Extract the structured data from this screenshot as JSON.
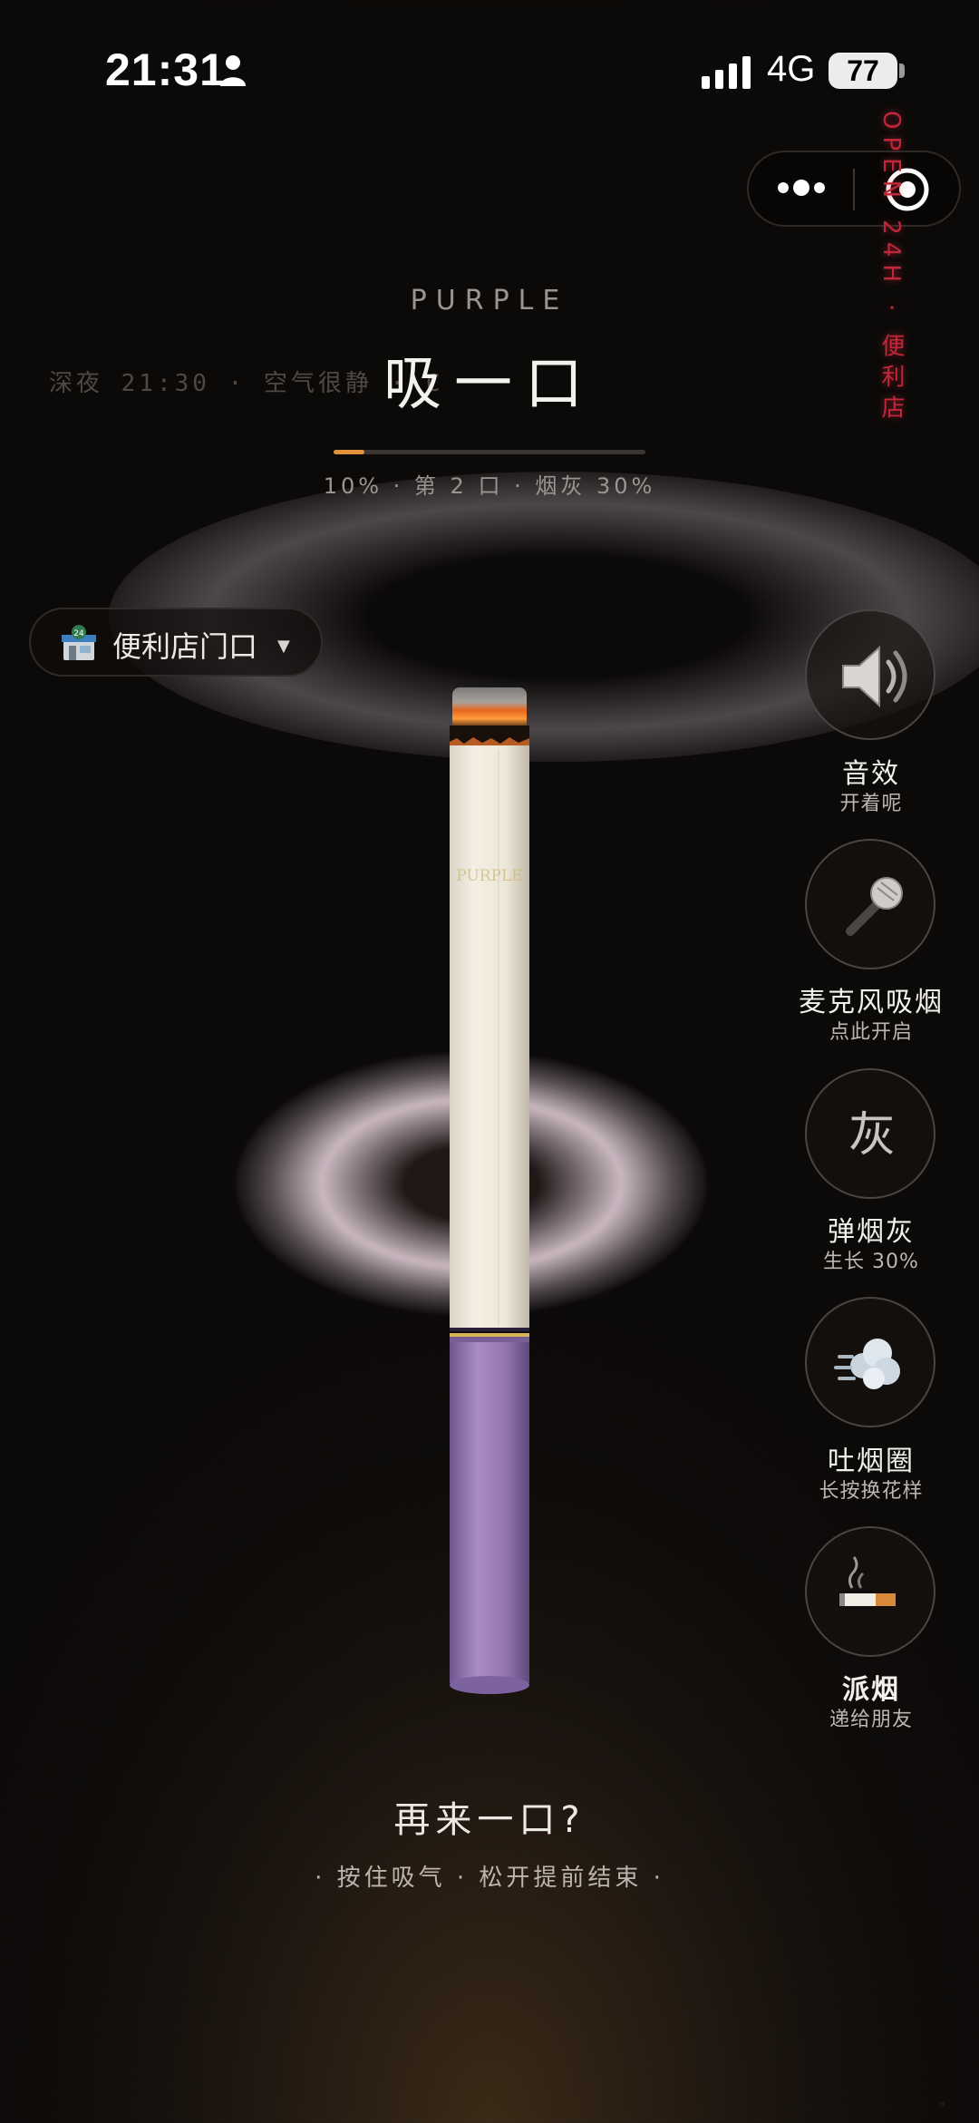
{
  "status_bar": {
    "time": "21:31",
    "network": "4G",
    "battery": "77"
  },
  "neon_sign": "OPEN 24H · 便利店",
  "header": {
    "brand": "PURPLE",
    "ambient": "深夜 21:30 · 空气很静 · C",
    "title": "吸一口",
    "progress_percent": 10,
    "progress_text": "10% · 第 2 口 · 烟灰 30%"
  },
  "location": {
    "label": "便利店门口"
  },
  "cigarette": {
    "brand_print": "PURPLE",
    "remaining_percent": 90
  },
  "actions": [
    {
      "id": "sound",
      "icon": "speaker-icon",
      "label": "音效",
      "sub": "开着呢"
    },
    {
      "id": "mic",
      "icon": "microphone-icon",
      "label": "麦克风吸烟",
      "sub": "点此开启"
    },
    {
      "id": "ash",
      "icon": "ash-glyph",
      "glyph": "灰",
      "label": "弹烟灰",
      "sub": "生长 30%"
    },
    {
      "id": "ring",
      "icon": "smoke-puff-icon",
      "label": "吐烟圈",
      "sub": "长按换花样"
    },
    {
      "id": "share",
      "icon": "cigarette-icon",
      "label": "派烟",
      "sub": "递给朋友"
    }
  ],
  "footer": {
    "again": "再来一口?",
    "hint": "· 按住吸气 · 松开提前结束 ·"
  },
  "colors": {
    "accent": "#e0913a",
    "neon": "#c0283a",
    "filter_purple": "#8a6aa8"
  }
}
